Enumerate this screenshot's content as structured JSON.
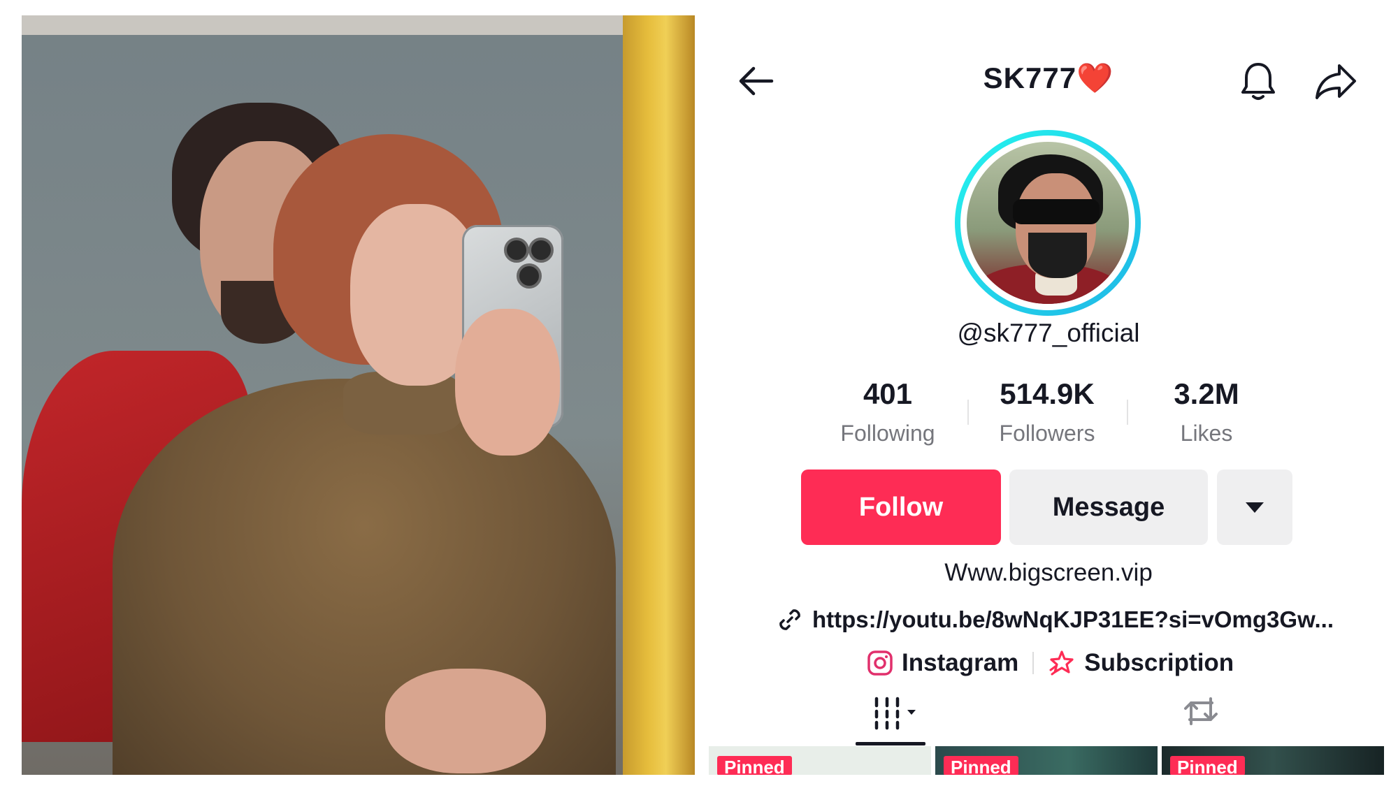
{
  "profile": {
    "title": "SK777",
    "title_emoji": "❤️",
    "handle": "@sk777_official",
    "bio": "Www.bigscreen.vip",
    "link": "https://youtu.be/8wNqKJP31EE?si=vOmg3Gw...",
    "avatar_icon": "profile-photo"
  },
  "stats": [
    {
      "value": "401",
      "label": "Following"
    },
    {
      "value": "514.9K",
      "label": "Followers"
    },
    {
      "value": "3.2M",
      "label": "Likes"
    }
  ],
  "actions": {
    "follow": "Follow",
    "message": "Message"
  },
  "socials": {
    "instagram": "Instagram",
    "subscription": "Subscription"
  },
  "grid": {
    "pinned_label": "Pinned"
  },
  "icons": {
    "back": "back-arrow-icon",
    "bell": "bell-icon",
    "share": "share-icon",
    "link": "link-icon",
    "instagram": "instagram-icon",
    "subscription": "subscription-icon",
    "videos_tab": "grid-icon",
    "repost_tab": "repost-icon"
  },
  "colors": {
    "follow_bg": "#fe2c55",
    "avatar_ring": "#25f4ee",
    "heart": "#e8232f"
  }
}
